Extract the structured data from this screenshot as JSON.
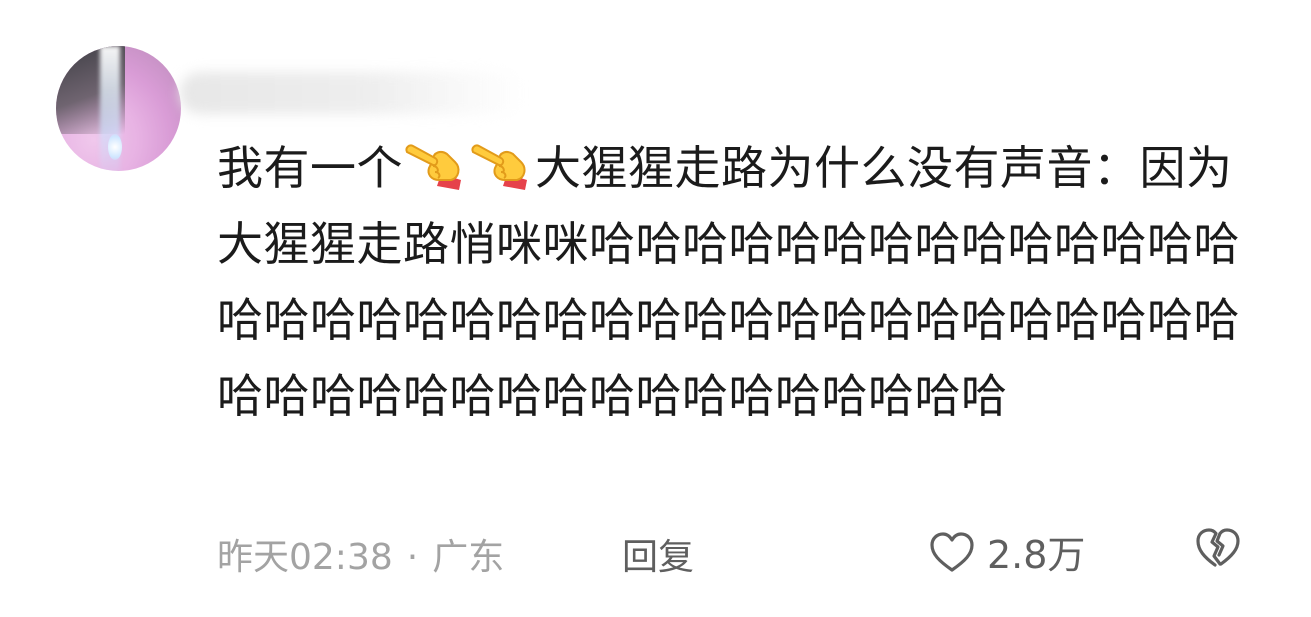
{
  "comment": {
    "text_before": "我有一个",
    "emoji_icon": "backhand-index-pointing-right-icon",
    "emoji_count": 2,
    "text_after": "大猩猩走路为什么没有声音：因为大猩猩走路悄咪咪哈哈哈哈哈哈哈哈哈哈哈哈哈哈哈哈哈哈哈哈哈哈哈哈哈哈哈哈哈哈哈哈哈哈哈哈哈哈哈哈哈哈哈哈哈哈哈哈哈哈哈哈哈",
    "timestamp": "昨天02:38",
    "separator": "·",
    "location": "广东",
    "reply_label": "回复",
    "like_count": "2.8万",
    "like_icon": "heart-outline-icon",
    "dislike_icon": "broken-heart-icon"
  },
  "colors": {
    "text": "#1b1b1b",
    "meta": "#a3a3a3",
    "action": "#5f5f5f",
    "avatar": "#e7b2e3"
  }
}
